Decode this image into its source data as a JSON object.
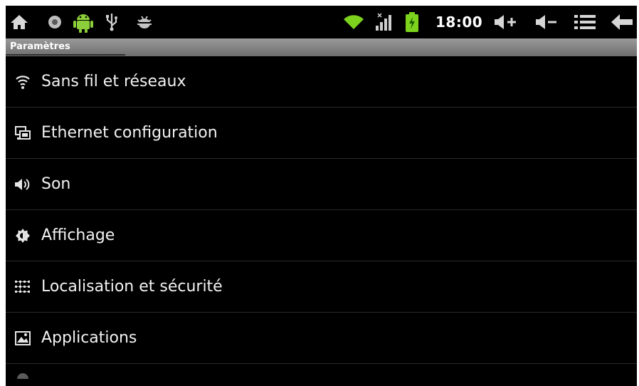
{
  "status_bar": {
    "time": "18:00",
    "icons": [
      "home-icon",
      "record-icon",
      "android-icon",
      "usb-icon",
      "bug-icon",
      "wifi-icon",
      "signal-icon",
      "battery-charging-icon",
      "volume-up-icon",
      "volume-down-icon",
      "menu-icon",
      "back-icon"
    ],
    "accent_green": "#7dd21e"
  },
  "title_bar": {
    "title": "Paramètres"
  },
  "settings": {
    "items": [
      {
        "label": "Sans fil et réseaux",
        "icon": "wireless-icon"
      },
      {
        "label": "Ethernet configuration",
        "icon": "ethernet-icon"
      },
      {
        "label": "Son",
        "icon": "speaker-icon"
      },
      {
        "label": "Affichage",
        "icon": "brightness-icon"
      },
      {
        "label": "Localisation et sécurité",
        "icon": "location-grid-icon"
      },
      {
        "label": "Applications",
        "icon": "applications-icon"
      }
    ]
  }
}
